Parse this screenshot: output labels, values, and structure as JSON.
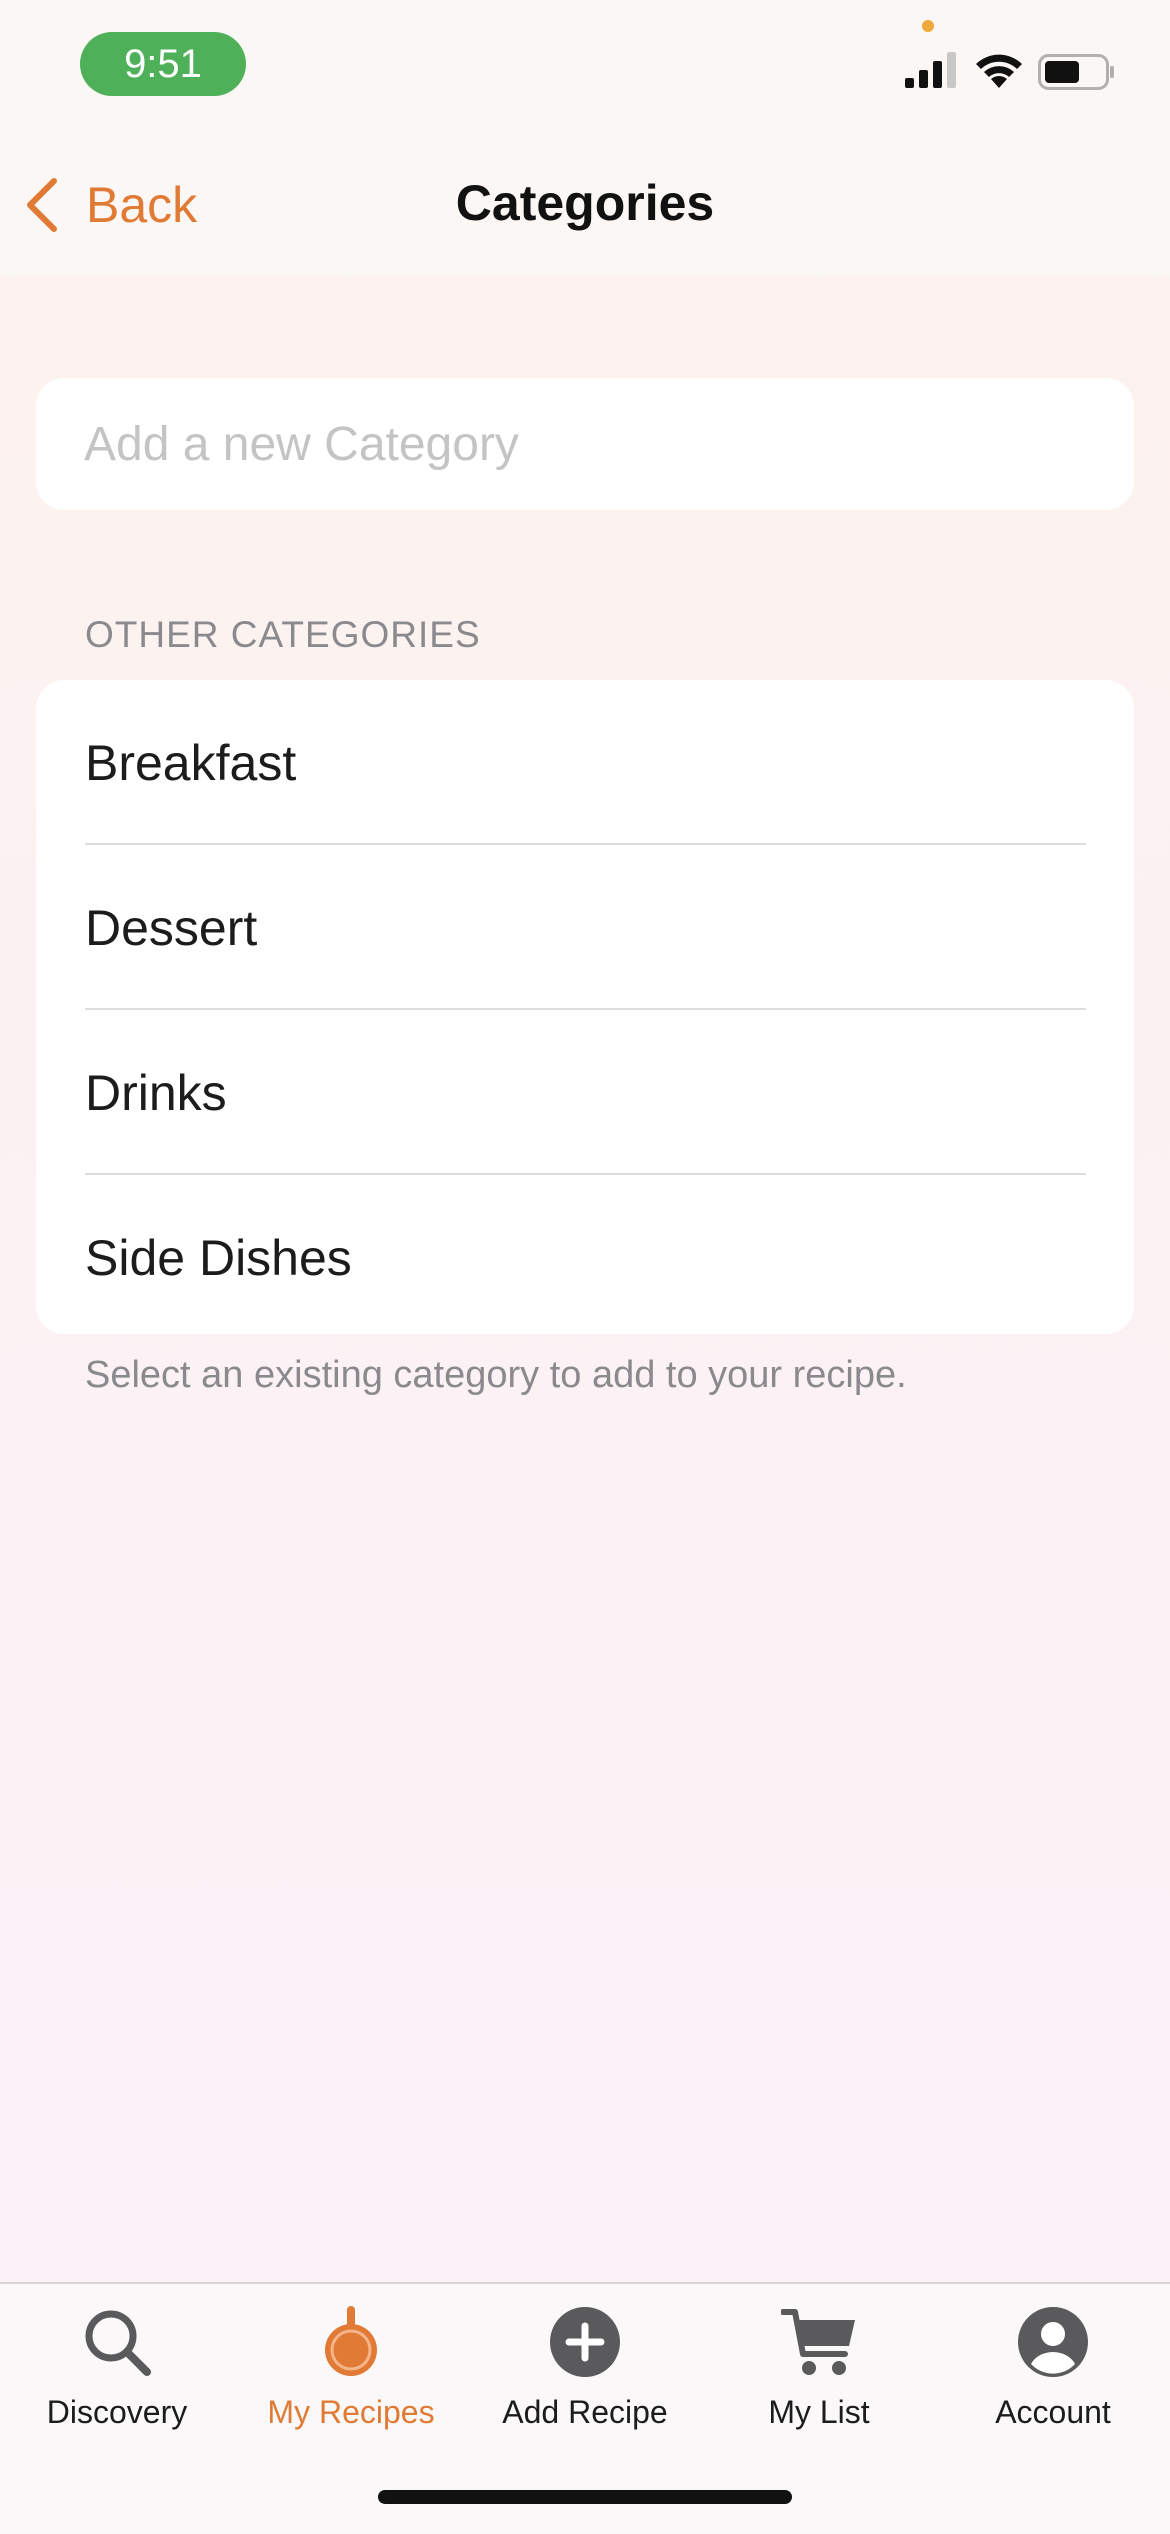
{
  "status_bar": {
    "time": "9:51"
  },
  "nav": {
    "back_label": "Back",
    "title": "Categories"
  },
  "new_category": {
    "placeholder": "Add a new Category"
  },
  "other_categories": {
    "header": "OTHER CATEGORIES",
    "items": [
      {
        "label": "Breakfast"
      },
      {
        "label": "Dessert"
      },
      {
        "label": "Drinks"
      },
      {
        "label": "Side Dishes"
      }
    ],
    "footer": "Select an existing category to add to your recipe."
  },
  "tab_bar": {
    "active_tab": "My Recipes",
    "tabs": [
      {
        "label": "Discovery",
        "icon": "search-icon"
      },
      {
        "label": "My Recipes",
        "icon": "pan-icon"
      },
      {
        "label": "Add Recipe",
        "icon": "plus-circle-icon"
      },
      {
        "label": "My List",
        "icon": "cart-icon"
      },
      {
        "label": "Account",
        "icon": "person-circle-icon"
      }
    ]
  },
  "colors": {
    "accent": "#e07a35",
    "status_pill": "#4fb05a",
    "secondary_text": "#8a8a8e",
    "icon_gray": "#5a5a5c"
  }
}
